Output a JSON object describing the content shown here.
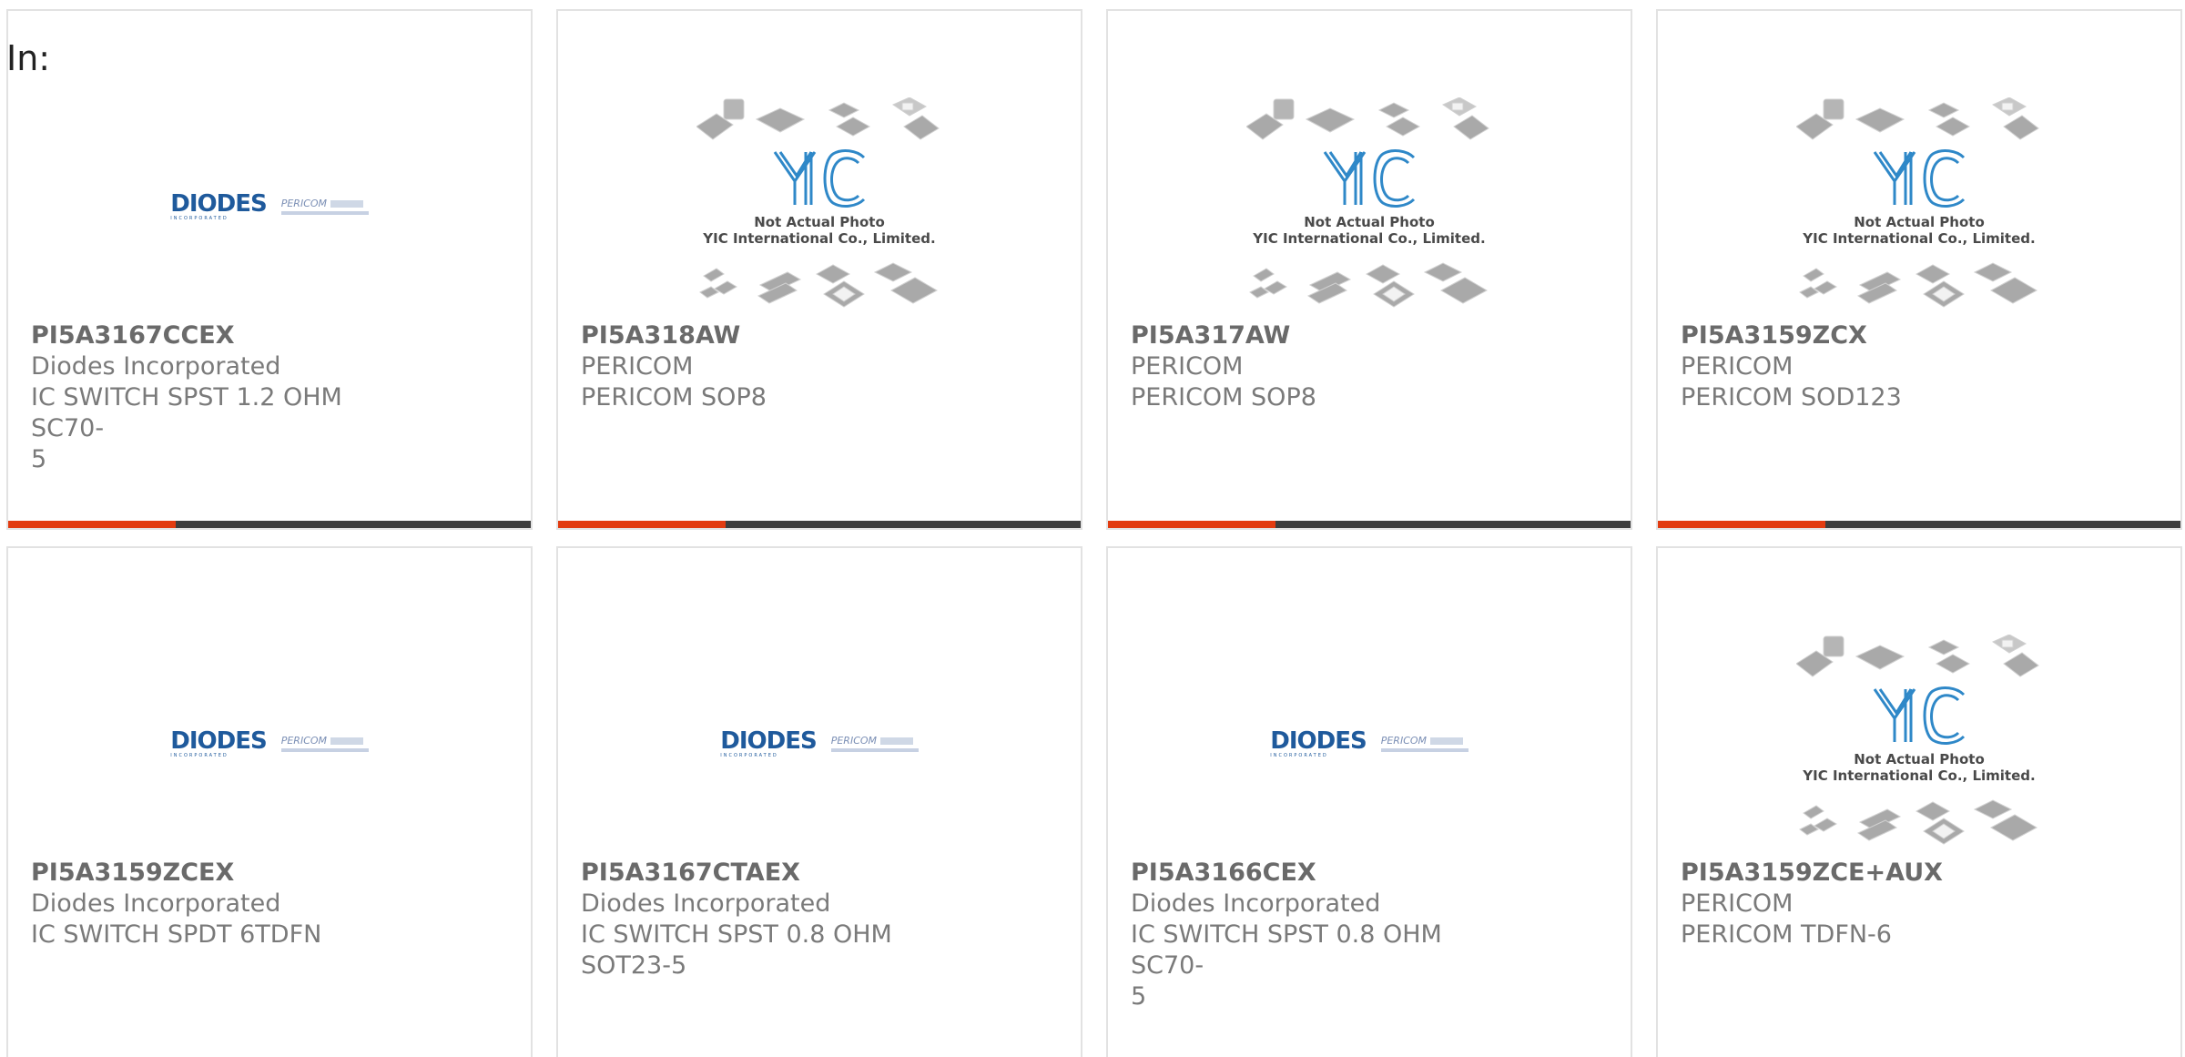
{
  "header": {
    "in_label": "In:"
  },
  "placeholder": {
    "line1": "Not Actual Photo",
    "line2": "YIC International Co., Limited."
  },
  "colors": {
    "accent": "#e23b10",
    "bar": "#3d3d3d",
    "diodes_blue": "#1f5a9c",
    "yic_blue": "#2f88c8"
  },
  "logo_text": {
    "diodes": "DIODES",
    "diodes_sub": "INCORPORATED",
    "pericom": "PERICOM"
  },
  "products": [
    {
      "part_number": "PI5A3167CCEX",
      "manufacturer": "Diodes Incorporated",
      "desc_line1": "IC SWITCH SPST 1.2 OHM SC70-",
      "desc_line2": "5",
      "image": "diodes-logo"
    },
    {
      "part_number": "PI5A318AW",
      "manufacturer": "PERICOM",
      "desc_line1": "PERICOM SOP8",
      "desc_line2": "",
      "image": "yic-placeholder"
    },
    {
      "part_number": "PI5A317AW",
      "manufacturer": "PERICOM",
      "desc_line1": "PERICOM SOP8",
      "desc_line2": "",
      "image": "yic-placeholder"
    },
    {
      "part_number": "PI5A3159ZCX",
      "manufacturer": "PERICOM",
      "desc_line1": "PERICOM SOD123",
      "desc_line2": "",
      "image": "yic-placeholder"
    },
    {
      "part_number": "PI5A3159ZCEX",
      "manufacturer": "Diodes Incorporated",
      "desc_line1": "IC SWITCH SPDT 6TDFN",
      "desc_line2": "",
      "image": "diodes-logo"
    },
    {
      "part_number": "PI5A3167CTAEX",
      "manufacturer": "Diodes Incorporated",
      "desc_line1": "IC SWITCH SPST 0.8 OHM",
      "desc_line2": "SOT23-5",
      "image": "diodes-logo"
    },
    {
      "part_number": "PI5A3166CEX",
      "manufacturer": "Diodes Incorporated",
      "desc_line1": "IC SWITCH SPST 0.8 OHM SC70-",
      "desc_line2": "5",
      "image": "diodes-logo"
    },
    {
      "part_number": "PI5A3159ZCE+AUX",
      "manufacturer": "PERICOM",
      "desc_line1": "PERICOM TDFN-6",
      "desc_line2": "",
      "image": "yic-placeholder"
    }
  ]
}
